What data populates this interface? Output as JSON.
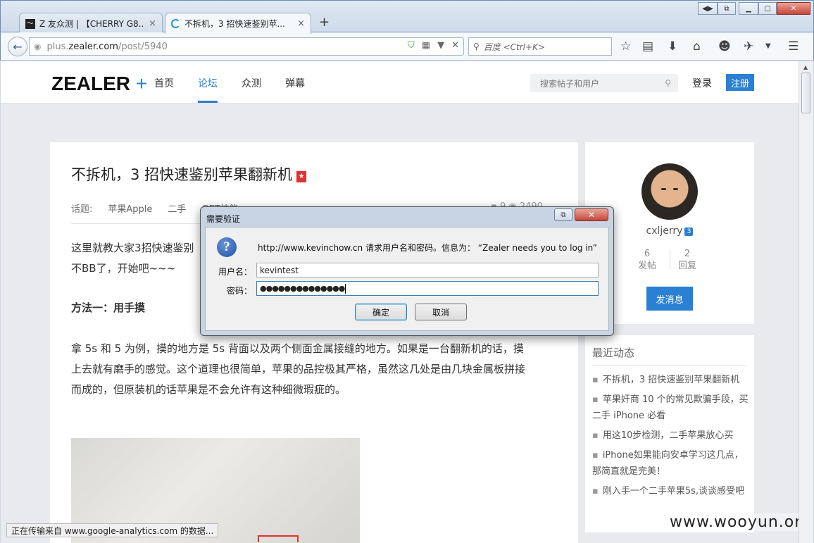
{
  "browser": {
    "tabs": [
      {
        "label": "Z 友众测 | 【CHERRY G8...",
        "icon": "activity-icon"
      },
      {
        "label": "不拆机，3 招快速鉴别苹...",
        "icon": "loading-spinner-icon"
      }
    ],
    "url": {
      "prefix": "plus.",
      "domain": "zealer.com",
      "path": "/post/5940"
    },
    "search_placeholder": "百度 <Ctrl+K>",
    "new_tab_label": "+",
    "close_label": "×"
  },
  "site": {
    "logo": "ZEALER",
    "logo_plus": "+",
    "nav": [
      "首页",
      "论坛",
      "众测",
      "弹幕"
    ],
    "search_placeholder": "搜索帖子和用户",
    "login": "登录",
    "register": "注册"
  },
  "article": {
    "title": "不拆机，3 招快速鉴别苹果翻新机",
    "flag": "★",
    "topic_label": "话题:",
    "tags": [
      "苹果Apple",
      "二手",
      "GET技能"
    ],
    "comments": "9",
    "views": "2490",
    "para1": "这里就教大家3招快速鉴别",
    "para2": "不BB了，开始吧~~~",
    "method1": "方法一：用手摸",
    "para3_line1": "拿 5s 和 5 为例，摸的地方是 5s 背面以及两个侧面金属接缝的地方。如果是一台翻新机的话，摸",
    "para3_line2": "上去就有磨手的感觉。这个道理也很简单，苹果的品控极其严格，虽然这几处是由几块金属板拼接",
    "para3_line3": "而成的，但原装机的话苹果是不会允许有这种细微瑕疵的。"
  },
  "profile": {
    "username": "cxljerry",
    "level": "3",
    "posts_count": "6",
    "posts_label": "发帖",
    "replies_count": "2",
    "replies_label": "回复",
    "message_button": "发消息"
  },
  "recent": {
    "title": "最近动态",
    "items": [
      "不拆机，3 招快速鉴别苹果翻新机",
      "苹果奸商 10 个的常见欺骗手段，买二手 iPhone 必看",
      "用这10步检测，二手苹果放心买",
      "iPhone如果能向安卓学习这几点，那简直就是完美！",
      "刚入手一个二手苹果5s,谈谈感受吧"
    ]
  },
  "status_bar": "正在传输来自 www.google-analytics.com 的数据...",
  "watermark": "www.wooyun.org",
  "dialog": {
    "title": "需要验证",
    "message": "http://www.kevinchow.cn 请求用户名和密码。信息为：  “Zealer needs you to log in”",
    "username_label": "用户名：",
    "username_value": "kevintest",
    "password_label": "密码：",
    "password_value": "●●●●●●●●●●●●●●",
    "ok": "确定",
    "cancel": "取消",
    "close": "✕",
    "restore": "⧉"
  },
  "colors": {
    "accent": "#2a80d3",
    "flag": "#e03030",
    "close_red": "#c7463a"
  }
}
